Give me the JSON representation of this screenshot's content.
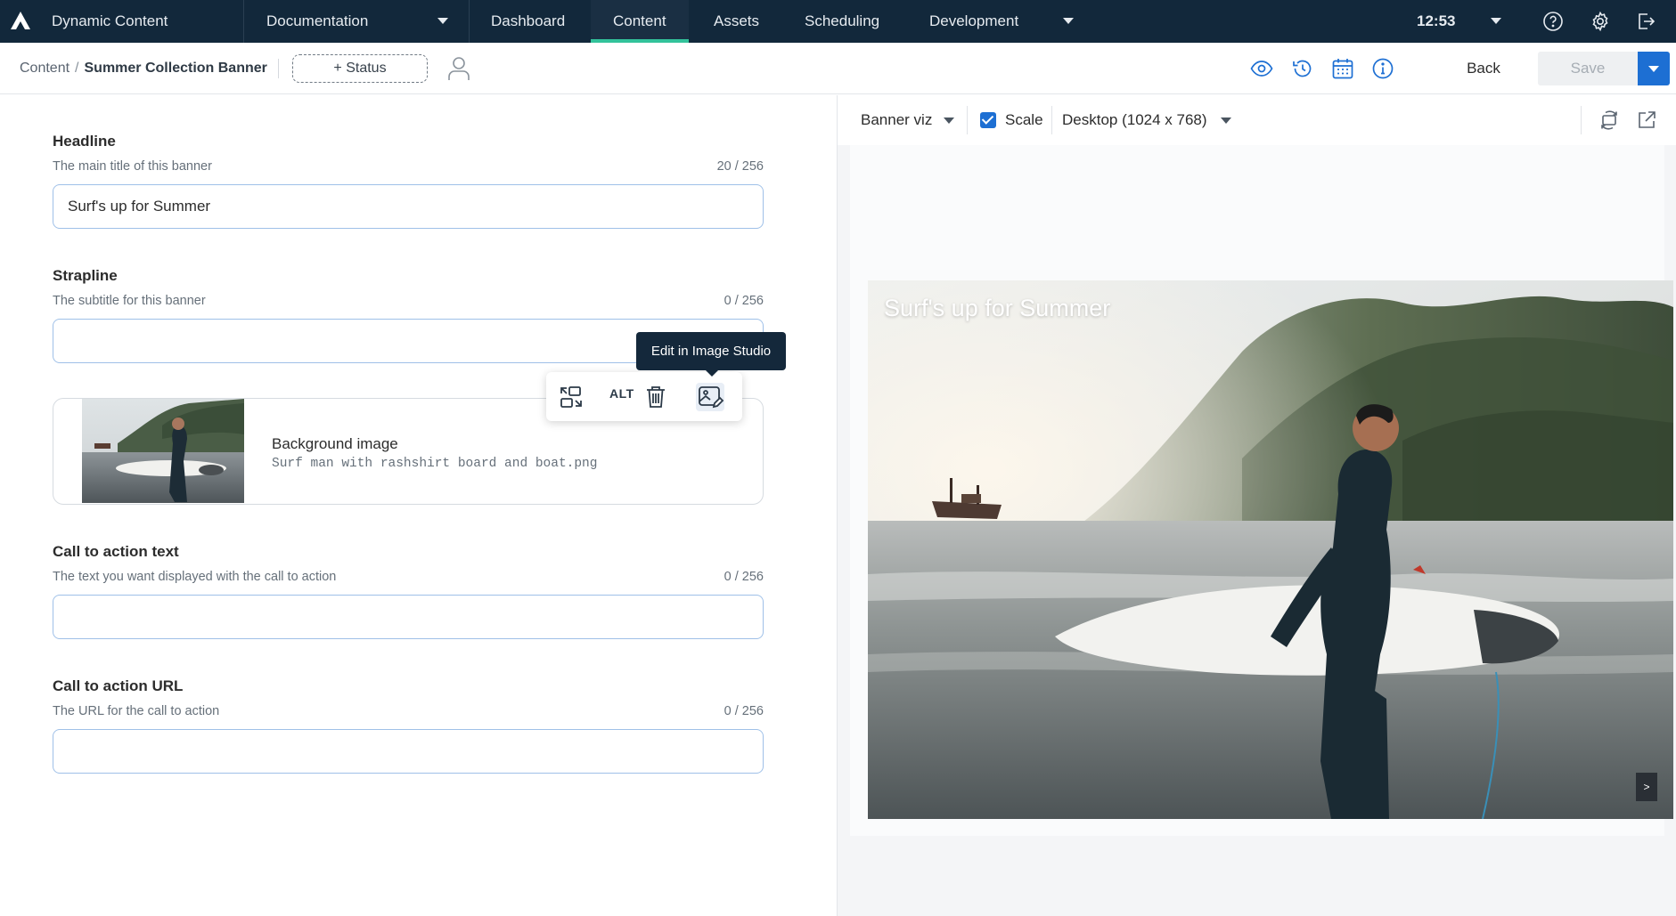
{
  "app": {
    "name": "Dynamic Content"
  },
  "topnav": {
    "hub": "Documentation",
    "items": [
      "Dashboard",
      "Content",
      "Assets",
      "Scheduling",
      "Development"
    ],
    "active": "Content",
    "time": "12:53"
  },
  "breadcrumb": {
    "root": "Content",
    "separator": "/",
    "current": "Summer Collection Banner"
  },
  "toolbar": {
    "status_label": "+ Status",
    "back_label": "Back",
    "save_label": "Save"
  },
  "form": {
    "headline": {
      "title": "Headline",
      "desc": "The main title of this banner",
      "count": "20 / 256",
      "value": "Surf's up for Summer"
    },
    "strapline": {
      "title": "Strapline",
      "desc": "The subtitle for this banner",
      "count": "0 / 256",
      "value": ""
    },
    "image": {
      "title": "Background image",
      "filename": "Surf man with rashshirt board and boat.png"
    },
    "image_toolbar": {
      "alt_label": "ALT",
      "tooltip": "Edit in Image Studio"
    },
    "cta_text": {
      "title": "Call to action text",
      "desc": "The text you want displayed with the call to action",
      "count": "0 / 256",
      "value": ""
    },
    "cta_url": {
      "title": "Call to action URL",
      "desc": "The URL for the call to action",
      "count": "0 / 256",
      "value": ""
    }
  },
  "preview": {
    "visualization": "Banner viz",
    "scale_label": "Scale",
    "scale_checked": true,
    "device": "Desktop (1024 x 768)",
    "banner_title": "Surf's up for Summer",
    "next_label": ">"
  },
  "colors": {
    "topbar": "#12283b",
    "accent_green": "#33c29a",
    "primary_blue": "#1d6fd3",
    "input_border": "#9fc0e8"
  }
}
